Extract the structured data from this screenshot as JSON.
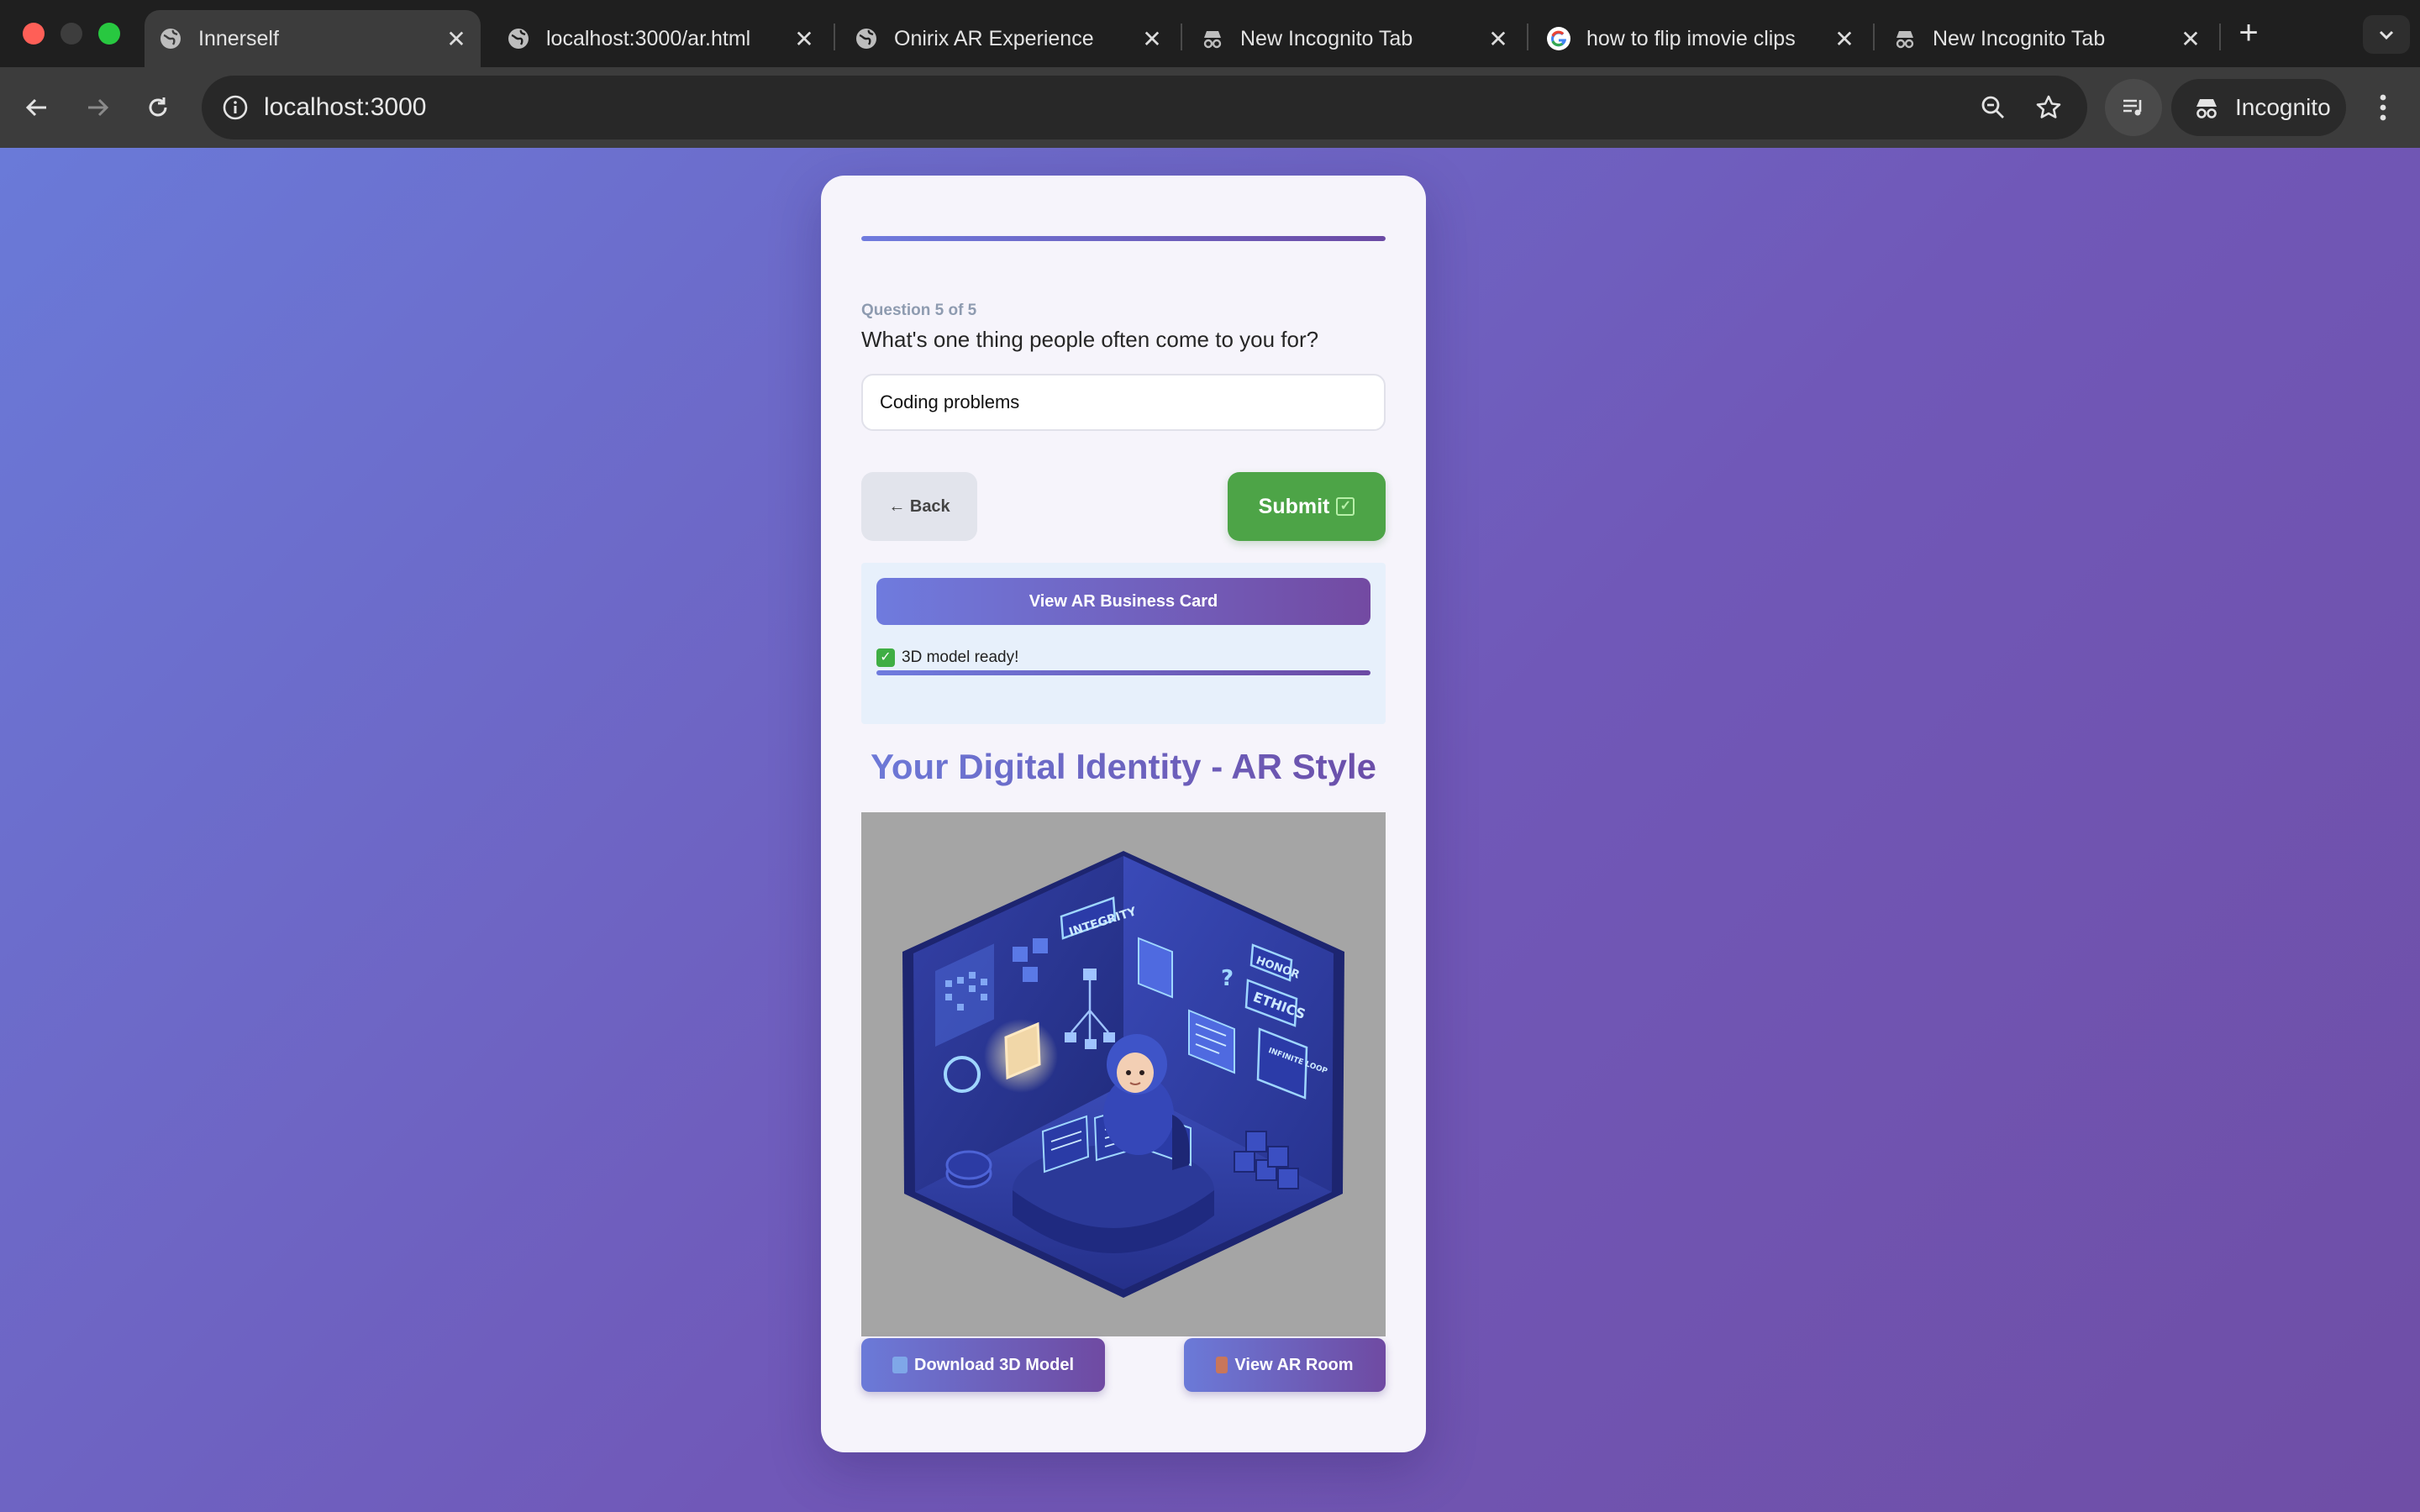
{
  "browser": {
    "tabs": [
      {
        "title": "Innerself",
        "icon": "globe-icon",
        "active": true
      },
      {
        "title": "localhost:3000/ar.html",
        "icon": "globe-icon",
        "active": false
      },
      {
        "title": "Onirix AR Experience",
        "icon": "globe-icon",
        "active": false
      },
      {
        "title": "New Incognito Tab",
        "icon": "incognito-icon",
        "active": false
      },
      {
        "title": "how to flip imovie clips",
        "icon": "google-icon",
        "active": false
      },
      {
        "title": "New Incognito Tab",
        "icon": "incognito-icon",
        "active": false
      }
    ],
    "url": "localhost:3000",
    "profile_label": "Incognito"
  },
  "quiz": {
    "progress_fraction": 1.0,
    "counter": "Question 5 of 5",
    "question": "What's one thing people often come to you for?",
    "answer_value": "Coding problems",
    "back_label": "← Back",
    "submit_label": "Submit"
  },
  "ar": {
    "card_button_label": "View AR Business Card",
    "status_text": "3D model ready!",
    "status_progress_fraction": 1.0
  },
  "identity": {
    "title": "Your Digital Identity - AR Style",
    "scene_labels": [
      "INTEGRITY",
      "HONOR",
      "ETHICS",
      "INFINITE LOOP",
      "?"
    ],
    "download_label": "Download 3D Model",
    "room_label": "View AR Room"
  },
  "colors": {
    "accent_gradient_start": "#6f7bde",
    "accent_gradient_end": "#6b4aa4",
    "submit_green": "#4da447"
  }
}
